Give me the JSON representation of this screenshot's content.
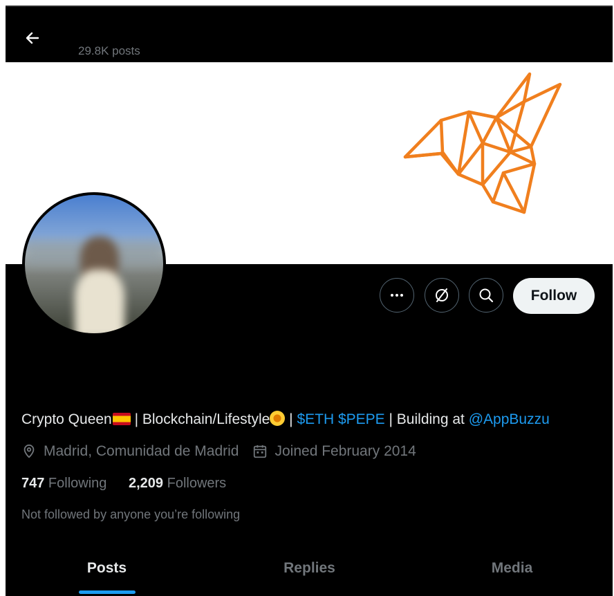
{
  "header": {
    "post_count": "29.8K posts",
    "back_icon": "arrow-left-icon"
  },
  "banner": {
    "logo": "hummingbird-logo",
    "accent": "#f07f1e"
  },
  "actions": {
    "more_icon": "more-dots-icon",
    "subscribe_icon": "circle-slash-icon",
    "search_icon": "search-icon",
    "follow_label": "Follow"
  },
  "profile": {
    "bio": {
      "name": "Crypto Queen",
      "sep1": " | Blockchain/Lifestyle",
      "sep2": " | ",
      "cashtags": "$ETH $PEPE",
      "building": " | Building at ",
      "mention": "@AppBuzzu"
    },
    "location": "Madrid, Comunidad de Madrid",
    "joined": "Joined February 2014",
    "following_count": "747",
    "following_label": " Following",
    "followers_count": "2,209",
    "followers_label": " Followers",
    "not_followed": "Not followed by anyone you’re following"
  },
  "tabs": [
    {
      "label": "Posts",
      "active": true
    },
    {
      "label": "Replies",
      "active": false
    },
    {
      "label": "Media",
      "active": false
    }
  ],
  "colors": {
    "link": "#1d9bf0",
    "background": "#000000",
    "muted": "#71767b"
  }
}
